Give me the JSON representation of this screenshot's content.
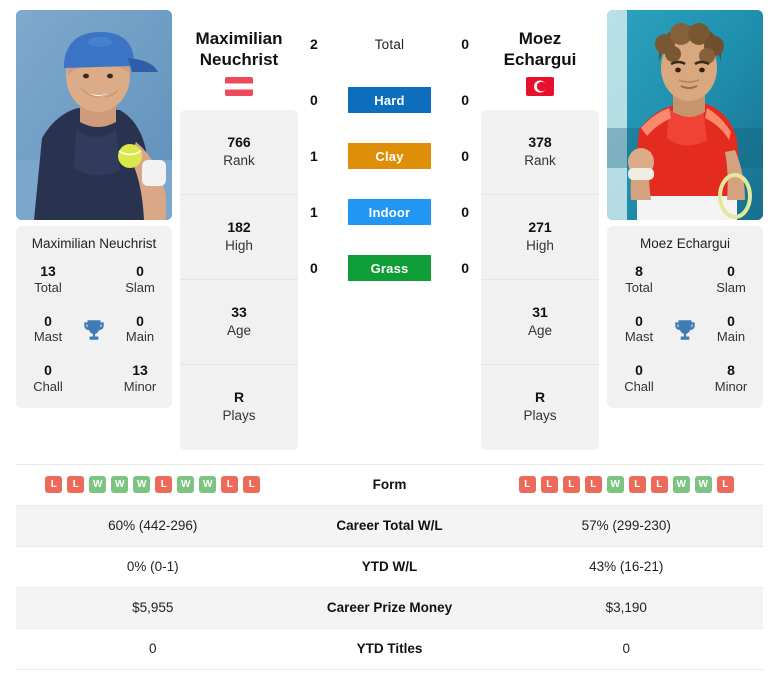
{
  "players": {
    "left": {
      "first_name": "Maximilian",
      "last_name": "Neuchrist",
      "full_name": "Maximilian Neuchrist",
      "country": "Austria",
      "flag": "austria-flag",
      "photo_alt": "Maximilian Neuchrist photo",
      "stats": [
        {
          "num": "766",
          "label": "Rank"
        },
        {
          "num": "182",
          "label": "High"
        },
        {
          "num": "33",
          "label": "Age"
        },
        {
          "num": "R",
          "label": "Plays"
        }
      ],
      "titles": [
        {
          "num": "13",
          "label": "Total"
        },
        {
          "num": "0",
          "label": "Slam"
        },
        {
          "num": "0",
          "label": "Mast"
        },
        {
          "num": "0",
          "label": "Main"
        },
        {
          "num": "0",
          "label": "Chall"
        },
        {
          "num": "13",
          "label": "Minor"
        }
      ],
      "form": [
        "L",
        "L",
        "W",
        "W",
        "W",
        "L",
        "W",
        "W",
        "L",
        "L"
      ],
      "career_total_wl": "60% (442-296)",
      "ytd_wl": "0% (0-1)",
      "career_prize_money": "$5,955",
      "ytd_titles": "0"
    },
    "right": {
      "first_name": "Moez",
      "last_name": "Echargui",
      "full_name": "Moez Echargui",
      "country": "Tunisia",
      "flag": "tunisia-flag",
      "photo_alt": "Moez Echargui photo",
      "stats": [
        {
          "num": "378",
          "label": "Rank"
        },
        {
          "num": "271",
          "label": "High"
        },
        {
          "num": "31",
          "label": "Age"
        },
        {
          "num": "R",
          "label": "Plays"
        }
      ],
      "titles": [
        {
          "num": "8",
          "label": "Total"
        },
        {
          "num": "0",
          "label": "Slam"
        },
        {
          "num": "0",
          "label": "Mast"
        },
        {
          "num": "0",
          "label": "Main"
        },
        {
          "num": "0",
          "label": "Chall"
        },
        {
          "num": "8",
          "label": "Minor"
        }
      ],
      "form": [
        "L",
        "L",
        "L",
        "L",
        "W",
        "L",
        "L",
        "W",
        "W",
        "L"
      ],
      "career_total_wl": "57% (299-230)",
      "ytd_wl": "43% (16-21)",
      "career_prize_money": "$3,190",
      "ytd_titles": "0"
    }
  },
  "head_to_head": [
    {
      "label": "Total",
      "left": "2",
      "right": "0",
      "color": "",
      "style": "plain"
    },
    {
      "label": "Hard",
      "left": "0",
      "right": "0",
      "color": "#0d6ebd",
      "style": "pill"
    },
    {
      "label": "Clay",
      "left": "1",
      "right": "0",
      "color": "#df8e07",
      "style": "pill"
    },
    {
      "label": "Indoor",
      "left": "1",
      "right": "0",
      "color": "#2196f3",
      "style": "pill"
    },
    {
      "label": "Grass",
      "left": "0",
      "right": "0",
      "color": "#0f9d38",
      "style": "pill"
    }
  ],
  "table": [
    {
      "label": "Form",
      "type": "form",
      "left": "",
      "right": ""
    },
    {
      "label": "Career Total W/L",
      "type": "text",
      "left": "60% (442-296)",
      "right": "57% (299-230)"
    },
    {
      "label": "YTD W/L",
      "type": "text",
      "left": "0% (0-1)",
      "right": "43% (16-21)"
    },
    {
      "label": "Career Prize Money",
      "type": "text",
      "left": "$5,955",
      "right": "$3,190"
    },
    {
      "label": "YTD Titles",
      "type": "text",
      "left": "0",
      "right": "0"
    }
  ],
  "colors": {
    "hard": "#0d6ebd",
    "clay": "#df8e07",
    "indoor": "#2196f3",
    "grass": "#0f9d38",
    "win_badge": "#7cc47f",
    "loss_badge": "#ec6a5a",
    "trophy": "#3f7cb5",
    "panel_bg": "#f1f1f1"
  }
}
